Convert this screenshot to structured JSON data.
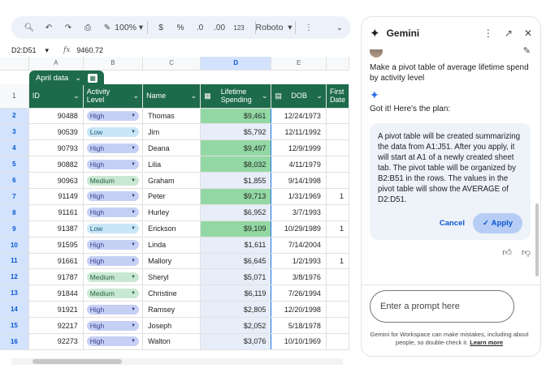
{
  "toolbar": {
    "zoom": "100%",
    "currency": "$",
    "percent": "%",
    "dec_less": ".0",
    "dec_more": ".00",
    "num_format": "123",
    "font": "Roboto"
  },
  "formula_bar": {
    "range": "D2:D51",
    "fx": "fx",
    "value": "9460.72"
  },
  "sheet": {
    "columns": [
      "A",
      "B",
      "C",
      "D",
      "E"
    ],
    "data_tab": "April data",
    "headers": {
      "id": "ID",
      "activity": [
        "Activity",
        "Level"
      ],
      "name": "Name",
      "spending": [
        "Lifetime",
        "Spending"
      ],
      "dob": "DOB",
      "first": [
        "First",
        "Date"
      ]
    },
    "rows": [
      {
        "row": "2",
        "id": "90488",
        "level": "High",
        "name": "Thomas",
        "spend": "$9,461",
        "dob": "12/24/1973",
        "first": ""
      },
      {
        "row": "3",
        "id": "90539",
        "level": "Low",
        "name": "Jim",
        "spend": "$5,792",
        "dob": "12/11/1992",
        "first": ""
      },
      {
        "row": "4",
        "id": "90793",
        "level": "High",
        "name": "Deana",
        "spend": "$9,497",
        "dob": "12/9/1999",
        "first": ""
      },
      {
        "row": "5",
        "id": "90882",
        "level": "High",
        "name": "Lilia",
        "spend": "$8,032",
        "dob": "4/11/1979",
        "first": ""
      },
      {
        "row": "6",
        "id": "90963",
        "level": "Medium",
        "name": "Graham",
        "spend": "$1,855",
        "dob": "9/14/1998",
        "first": ""
      },
      {
        "row": "7",
        "id": "91149",
        "level": "High",
        "name": "Peter",
        "spend": "$9,713",
        "dob": "1/31/1969",
        "first": "1"
      },
      {
        "row": "8",
        "id": "91161",
        "level": "High",
        "name": "Hurley",
        "spend": "$6,952",
        "dob": "3/7/1993",
        "first": ""
      },
      {
        "row": "9",
        "id": "91387",
        "level": "Low",
        "name": "Erickson",
        "spend": "$9,109",
        "dob": "10/29/1989",
        "first": "1"
      },
      {
        "row": "10",
        "id": "91595",
        "level": "High",
        "name": "Linda",
        "spend": "$1,611",
        "dob": "7/14/2004",
        "first": ""
      },
      {
        "row": "11",
        "id": "91661",
        "level": "High",
        "name": "Mallory",
        "spend": "$6,645",
        "dob": "1/2/1993",
        "first": "1"
      },
      {
        "row": "12",
        "id": "91787",
        "level": "Medium",
        "name": "Sheryl",
        "spend": "$5,071",
        "dob": "3/8/1976",
        "first": ""
      },
      {
        "row": "13",
        "id": "91844",
        "level": "Medium",
        "name": "Christine",
        "spend": "$6,119",
        "dob": "7/26/1994",
        "first": ""
      },
      {
        "row": "14",
        "id": "91921",
        "level": "High",
        "name": "Ramsey",
        "spend": "$2,805",
        "dob": "12/20/1998",
        "first": ""
      },
      {
        "row": "15",
        "id": "92217",
        "level": "High",
        "name": "Joseph",
        "spend": "$2,052",
        "dob": "5/18/1978",
        "first": ""
      },
      {
        "row": "16",
        "id": "92273",
        "level": "High",
        "name": "Walton",
        "spend": "$3,076",
        "dob": "10/10/1969",
        "first": ""
      }
    ]
  },
  "gemini": {
    "title": "Gemini",
    "user_prompt": "Make a pivot table of average lifetime spend by activity level",
    "reply_intro": "Got it! Here's the plan:",
    "plan": "A pivot table will be created summarizing the data from A1:J51. After you apply, it will start at A1 of a newly created sheet tab. The pivot table will be organized by B2:B51 in the rows. The values in the pivot table will show the AVERAGE of D2:D51.",
    "cancel": "Cancel",
    "apply": "Apply",
    "prompt_placeholder": "Enter a prompt here",
    "disclaimer": "Gemini for Workspace can make mistakes, including about people, so double-check it.",
    "learn_more": "Learn more"
  },
  "colors": {
    "header_green": "#1e6b4c",
    "high_spend_green": "#93d8a4",
    "accent_blue": "#0b57d0"
  }
}
